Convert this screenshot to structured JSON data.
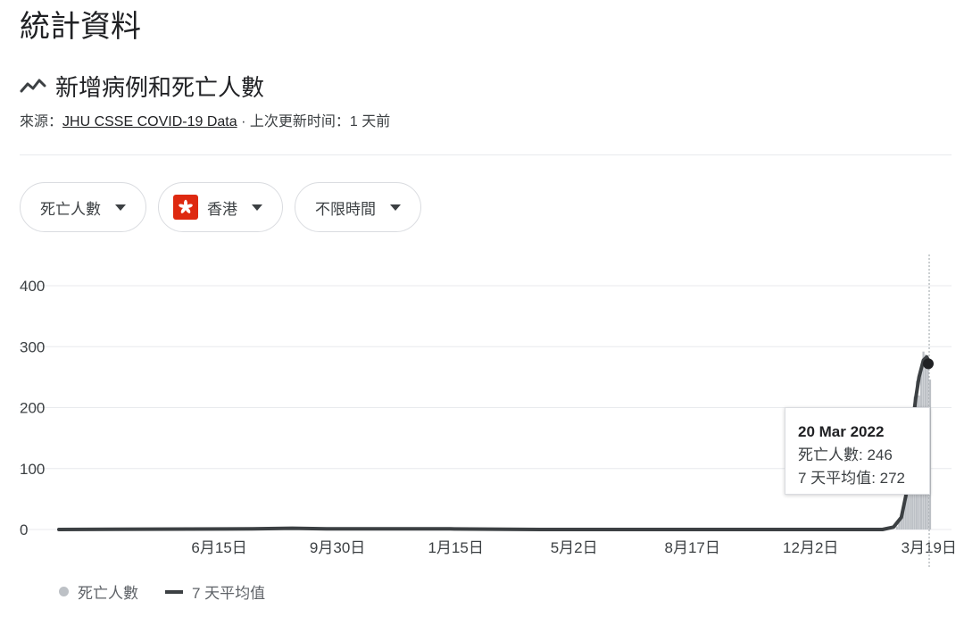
{
  "page": {
    "title": "統計資料"
  },
  "section": {
    "title": "新增病例和死亡人數",
    "icon": "trend-line-icon",
    "source_prefix": "來源：",
    "source_link": "JHU CSSE COVID-19 Data",
    "source_suffix": " · 上次更新时间：1 天前"
  },
  "filters": {
    "metric": "死亡人數",
    "region": "香港",
    "region_icon": "hong-kong-flag-icon",
    "time": "不限時間"
  },
  "tooltip": {
    "date": "20 Mar 2022",
    "line1_label": "死亡人數",
    "line1_value": "246",
    "line2_label": "7 天平均值",
    "line2_value": "272"
  },
  "legend": {
    "bar": "死亡人數",
    "line": "7 天平均值"
  },
  "colors": {
    "bar": "#bdc1c6",
    "line": "#3c4043",
    "grid": "#e8eaed",
    "flag": "#de2910"
  },
  "chart_data": {
    "type": "bar",
    "x_type": "date",
    "x_range": [
      "2020-01-22",
      "2022-03-20"
    ],
    "ylim": [
      0,
      400
    ],
    "yticks": [
      0,
      100,
      200,
      300,
      400
    ],
    "xticks": [
      {
        "label": "6月15日",
        "date": "2020-06-15"
      },
      {
        "label": "9月30日",
        "date": "2020-09-30"
      },
      {
        "label": "1月15日",
        "date": "2021-01-15"
      },
      {
        "label": "5月2日",
        "date": "2021-05-02"
      },
      {
        "label": "8月17日",
        "date": "2021-08-17"
      },
      {
        "label": "12月2日",
        "date": "2021-12-02"
      },
      {
        "label": "3月19日",
        "date": "2022-03-19"
      }
    ],
    "series": [
      {
        "name": "死亡人數",
        "kind": "bar",
        "points": [
          [
            "2022-02-18",
            5
          ],
          [
            "2022-02-20",
            12
          ],
          [
            "2022-02-22",
            22
          ],
          [
            "2022-02-24",
            40
          ],
          [
            "2022-02-26",
            70
          ],
          [
            "2022-02-28",
            110
          ],
          [
            "2022-03-02",
            150
          ],
          [
            "2022-03-04",
            190
          ],
          [
            "2022-03-06",
            218
          ],
          [
            "2022-03-08",
            244
          ],
          [
            "2022-03-10",
            220
          ],
          [
            "2022-03-12",
            265
          ],
          [
            "2022-03-14",
            292
          ],
          [
            "2022-03-16",
            287
          ],
          [
            "2022-03-18",
            268
          ],
          [
            "2022-03-20",
            246
          ]
        ]
      },
      {
        "name": "7 天平均值",
        "kind": "line",
        "points": [
          [
            "2020-01-22",
            0
          ],
          [
            "2020-07-15",
            1
          ],
          [
            "2020-08-20",
            2
          ],
          [
            "2020-09-20",
            1
          ],
          [
            "2021-01-10",
            1
          ],
          [
            "2021-04-01",
            0
          ],
          [
            "2022-02-05",
            0
          ],
          [
            "2022-02-15",
            4
          ],
          [
            "2022-02-22",
            20
          ],
          [
            "2022-02-26",
            55
          ],
          [
            "2022-03-01",
            110
          ],
          [
            "2022-03-04",
            170
          ],
          [
            "2022-03-07",
            215
          ],
          [
            "2022-03-10",
            250
          ],
          [
            "2022-03-14",
            278
          ],
          [
            "2022-03-17",
            283
          ],
          [
            "2022-03-20",
            272
          ]
        ]
      }
    ]
  }
}
